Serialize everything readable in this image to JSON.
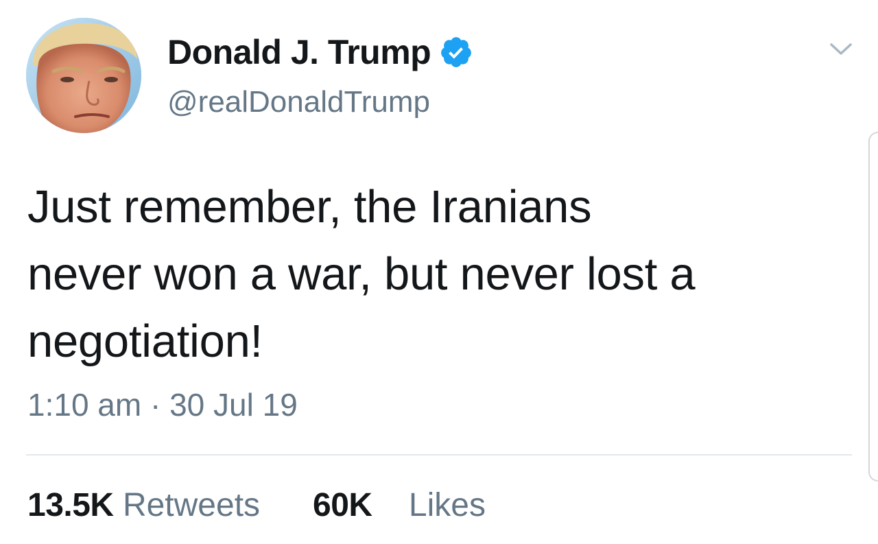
{
  "author": {
    "display_name": "Donald J. Trump",
    "handle": "@realDonaldTrump",
    "verified": true,
    "avatar_icon": "profile-photo"
  },
  "tweet": {
    "lines": [
      "Just remember, the Iranians",
      "never won a war, but never lost a",
      "negotiation!"
    ],
    "timestamp": "1:10 am · 30 Jul 19"
  },
  "stats": {
    "retweets_count": "13.5K",
    "retweets_label": "Retweets",
    "likes_count": "60K",
    "likes_label": "Likes"
  },
  "icons": {
    "verified": "verified-badge-icon",
    "menu": "chevron-down-icon"
  },
  "colors": {
    "text_primary": "#14171a",
    "text_secondary": "#657786",
    "verified_blue": "#1da1f2",
    "divider": "#e1e8ed"
  }
}
